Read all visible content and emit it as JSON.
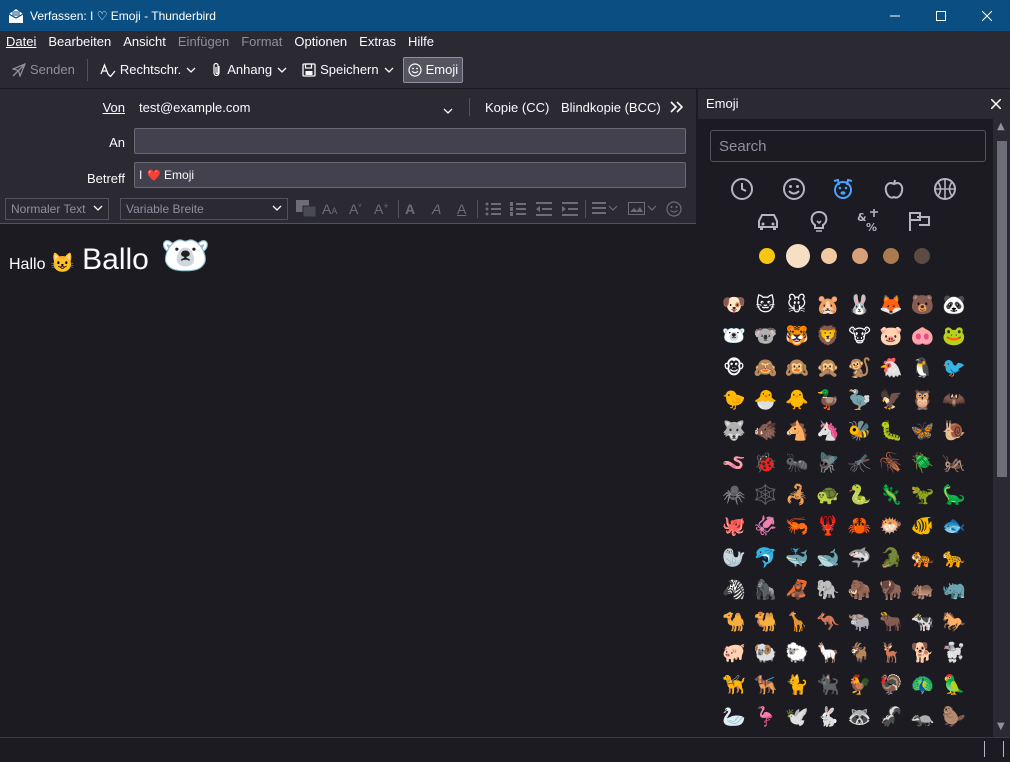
{
  "window": {
    "title": "Verfassen: I ♡ Emoji - Thunderbird"
  },
  "menubar": {
    "items": [
      {
        "label": "Datei",
        "disabled": false
      },
      {
        "label": "Bearbeiten",
        "disabled": false
      },
      {
        "label": "Ansicht",
        "disabled": false
      },
      {
        "label": "Einfügen",
        "disabled": true
      },
      {
        "label": "Format",
        "disabled": true
      },
      {
        "label": "Optionen",
        "disabled": false
      },
      {
        "label": "Extras",
        "disabled": false
      },
      {
        "label": "Hilfe",
        "disabled": false
      }
    ]
  },
  "toolbar": {
    "send_label": "Senden",
    "spelling_label": "Rechtschr.",
    "attach_label": "Anhang",
    "save_label": "Speichern",
    "emoji_label": "Emoji"
  },
  "header": {
    "from_label": "Von",
    "from_value": "test@example.com",
    "cc_label": "Kopie (CC)",
    "bcc_label": "Blindkopie (BCC)",
    "to_label": "An",
    "to_value": "",
    "subject_label": "Betreff",
    "subject_prefix": "I",
    "subject_heart": "❤️",
    "subject_suffix": "Emoji"
  },
  "format_bar": {
    "paragraph_format": "Normaler Text",
    "font": "Variable Breite"
  },
  "body": {
    "word1": "Hallo",
    "emoji1": "😺",
    "word2": "Ballo",
    "emoji2": "🐻‍❄️"
  },
  "emoji_panel": {
    "title": "Emoji",
    "search_placeholder": "Search",
    "categories": [
      "clock-icon",
      "smiley-icon",
      "dog-face-icon",
      "apple-icon",
      "basketball-icon",
      "car-icon",
      "lightbulb-icon",
      "symbols-icon",
      "flags-icon"
    ],
    "active_category": "dog-face-icon",
    "skin_tones": [
      "#f7c613",
      "#f6dfc3",
      "#f2c9a0",
      "#d6a07a",
      "#a97b4f",
      "#5d4a40"
    ],
    "selected_tone_index": 1,
    "emojis": [
      "🐶",
      "🐱",
      "🐭",
      "🐹",
      "🐰",
      "🦊",
      "🐻",
      "🐼",
      "🐻‍❄️",
      "🐨",
      "🐯",
      "🦁",
      "🐮",
      "🐷",
      "🐽",
      "🐸",
      "🐵",
      "🙈",
      "🙉",
      "🙊",
      "🐒",
      "🐔",
      "🐧",
      "🐦",
      "🐤",
      "🐣",
      "🐥",
      "🦆",
      "🦤",
      "🦅",
      "🦉",
      "🦇",
      "🐺",
      "🐗",
      "🐴",
      "🦄",
      "🐝",
      "🐛",
      "🦋",
      "🐌",
      "🪱",
      "🐞",
      "🐜",
      "🪰",
      "🦟",
      "🪳",
      "🪲",
      "🦗",
      "🕷️",
      "🕸️",
      "🦂",
      "🐢",
      "🐍",
      "🦎",
      "🦖",
      "🦕",
      "🐙",
      "🦑",
      "🦐",
      "🦞",
      "🦀",
      "🐡",
      "🐠",
      "🐟",
      "🦭",
      "🐬",
      "🐳",
      "🐋",
      "🦈",
      "🐊",
      "🐅",
      "🐆",
      "🦓",
      "🦍",
      "🦧",
      "🐘",
      "🦣",
      "🦬",
      "🦛",
      "🦏",
      "🐪",
      "🐫",
      "🦒",
      "🦘",
      "🐃",
      "🐂",
      "🐄",
      "🐎",
      "🐖",
      "🐏",
      "🐑",
      "🦙",
      "🐐",
      "🦌",
      "🐕",
      "🐩",
      "🦮",
      "🐕‍🦺",
      "🐈",
      "🐈‍⬛",
      "🐓",
      "🦃",
      "🦚",
      "🦜",
      "🦢",
      "🦩",
      "🕊️",
      "🐇",
      "🦝",
      "🦨",
      "🦡",
      "🦫"
    ]
  }
}
